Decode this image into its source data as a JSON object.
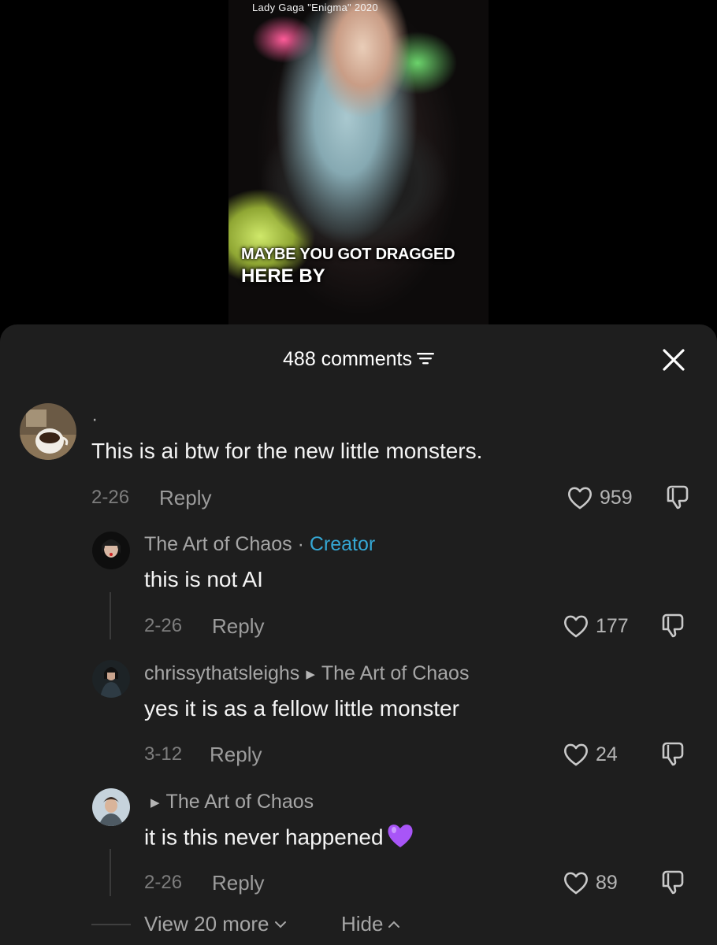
{
  "video": {
    "top_label": "Lady Gaga \"Enigma\" 2020",
    "caption_line1": "MAYBE YOU GOT DRAGGED",
    "caption_line2": "HERE BY"
  },
  "header": {
    "comment_count": "488 comments",
    "sort_icon": "sort-lines-icon",
    "close_icon": "close-icon"
  },
  "colors": {
    "sheet_bg": "#1e1e1e",
    "creator_accent": "#35a7d4",
    "muted_text": "#a6a6a6",
    "purple_heart": "#a855f7"
  },
  "comments": [
    {
      "username": "·",
      "text": "This is ai btw for the new little monsters.",
      "date": "2-26",
      "reply_label": "Reply",
      "likes": "959",
      "avatar_icon": "coffee-cup-avatar"
    },
    {
      "username": "The Art of Chaos",
      "separator": "·",
      "badge": "Creator",
      "text": "this is not AI",
      "date": "2-26",
      "reply_label": "Reply",
      "likes": "177"
    },
    {
      "username": "chrissythatsleighs",
      "reply_to": "The Art of Chaos",
      "text": "yes it is as a fellow little monster",
      "date": "3-12",
      "reply_label": "Reply",
      "likes": "24"
    },
    {
      "username": "",
      "reply_to": "The Art of Chaos",
      "text": "it is this never happened",
      "emoji": "purple-heart-icon",
      "date": "2-26",
      "reply_label": "Reply",
      "likes": "89"
    }
  ],
  "footer": {
    "view_more": "View 20 more",
    "hide": "Hide"
  }
}
